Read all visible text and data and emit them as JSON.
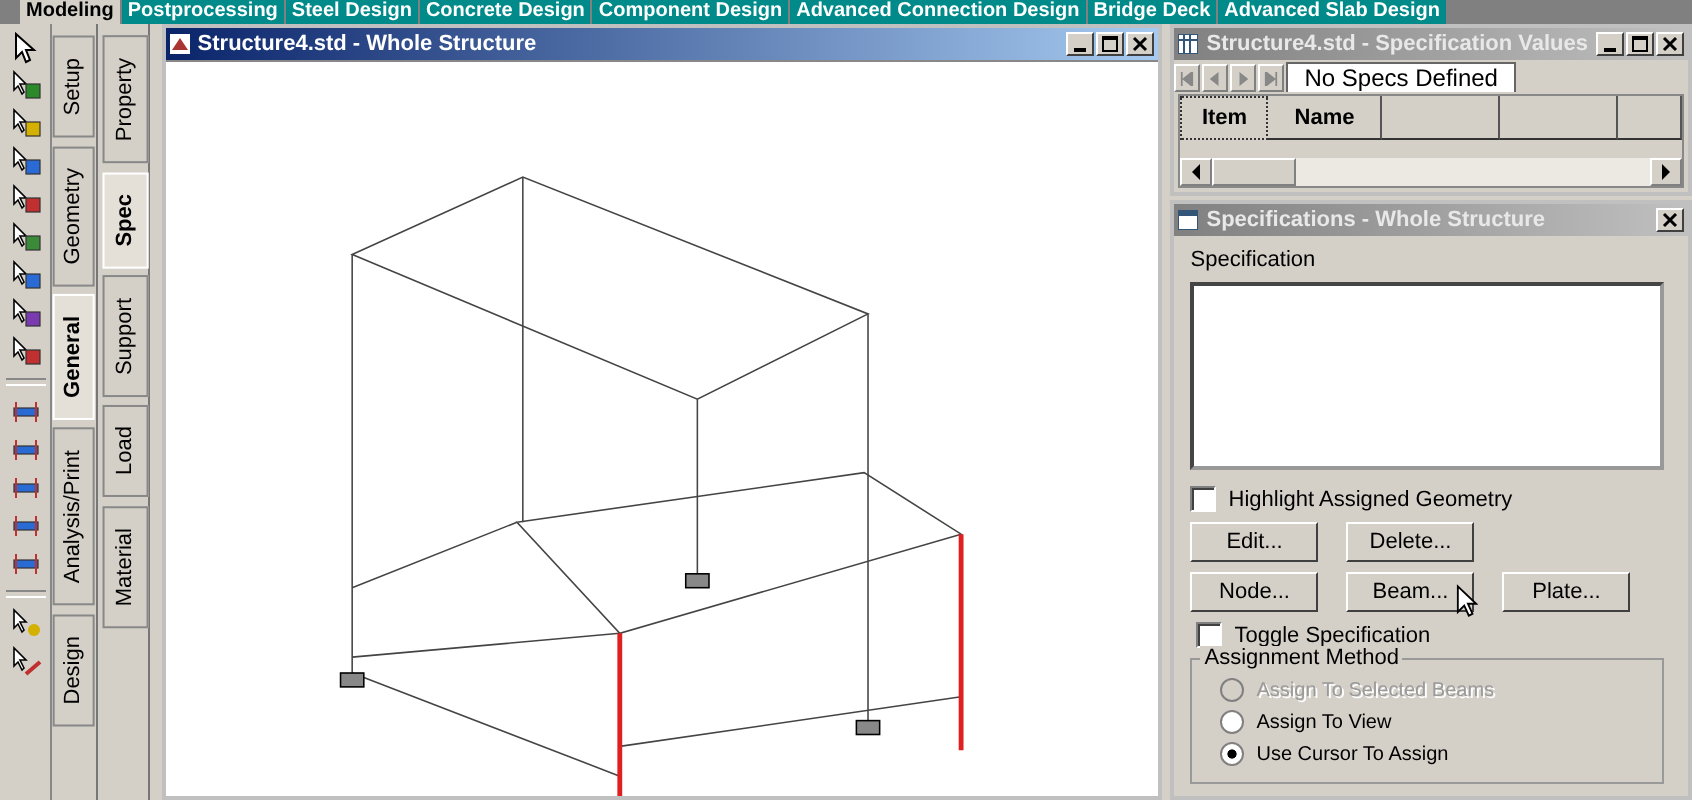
{
  "top_tabs": [
    {
      "label": "Modeling",
      "selected": true
    },
    {
      "label": "Postprocessing",
      "selected": false
    },
    {
      "label": "Steel Design",
      "selected": false
    },
    {
      "label": "Concrete Design",
      "selected": false
    },
    {
      "label": "Component Design",
      "selected": false
    },
    {
      "label": "Advanced Connection Design",
      "selected": false
    },
    {
      "label": "Bridge Deck",
      "selected": false
    },
    {
      "label": "Advanced Slab Design",
      "selected": false
    }
  ],
  "group_tabs": [
    {
      "label": "Setup",
      "selected": false
    },
    {
      "label": "Geometry",
      "selected": false
    },
    {
      "label": "General",
      "selected": true
    },
    {
      "label": "Analysis/Print",
      "selected": false
    },
    {
      "label": "Design",
      "selected": false
    }
  ],
  "page_tabs": [
    {
      "label": "Property",
      "selected": false
    },
    {
      "label": "Spec",
      "selected": true
    },
    {
      "label": "Support",
      "selected": false
    },
    {
      "label": "Load",
      "selected": false
    },
    {
      "label": "Material",
      "selected": false
    }
  ],
  "main_window": {
    "title": "Structure4.std - Whole Structure"
  },
  "spec_values": {
    "title": "Structure4.std - Specification Values",
    "tab": "No Specs Defined",
    "columns": [
      "Item",
      "Name"
    ]
  },
  "specifications": {
    "title": "Specifications - Whole Structure",
    "list_label": "Specification",
    "highlight": {
      "label": "Highlight Assigned Geometry",
      "checked": false
    },
    "buttons": [
      "Edit...",
      "Delete...",
      "Node...",
      "Beam...",
      "Plate..."
    ],
    "toggle": {
      "label": "Toggle Specification",
      "checked": false
    },
    "group_title": "Assignment Method",
    "options": [
      {
        "label": "Assign To Selected Beams",
        "selected": false,
        "disabled": true
      },
      {
        "label": "Assign To View",
        "selected": false,
        "disabled": false
      },
      {
        "label": "Use Cursor To Assign",
        "selected": true,
        "disabled": false
      }
    ]
  }
}
